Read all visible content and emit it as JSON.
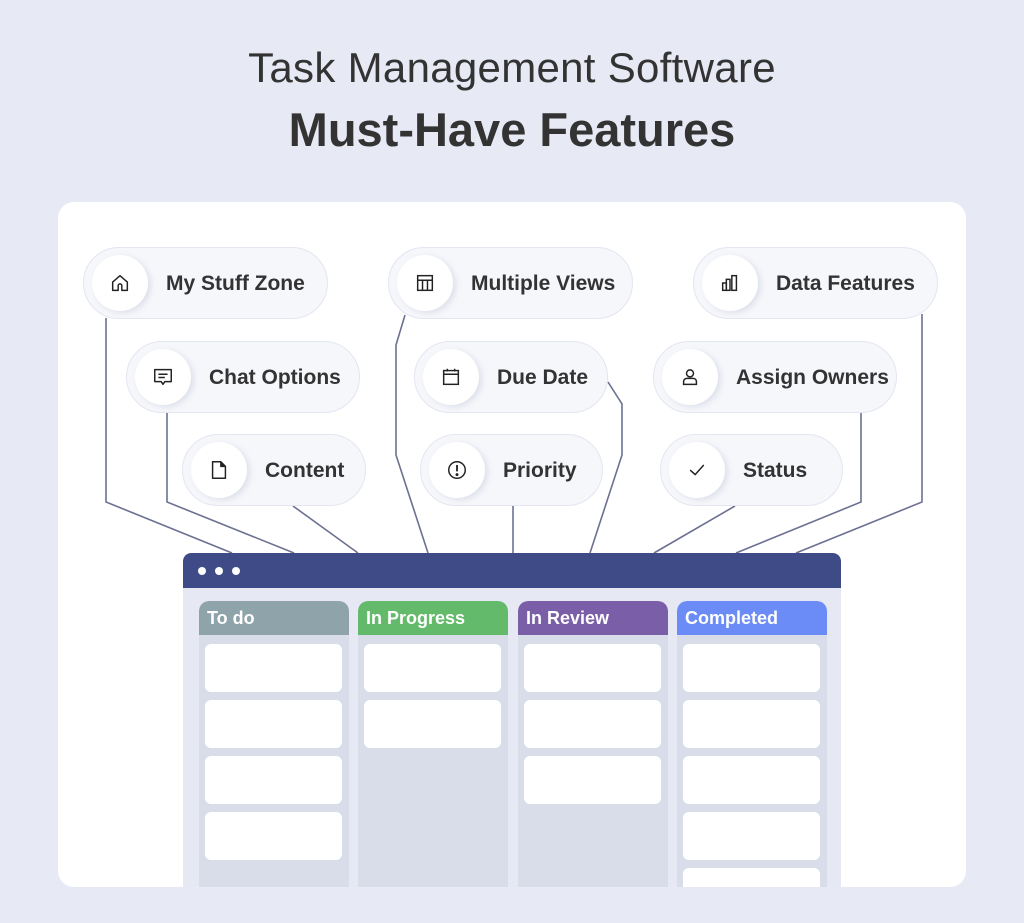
{
  "header": {
    "title": "Task Management Software",
    "subtitle": "Must-Have Features"
  },
  "features": [
    {
      "label": "My Stuff Zone",
      "icon": "home-icon"
    },
    {
      "label": "Chat Options",
      "icon": "chat-icon"
    },
    {
      "label": "Content",
      "icon": "document-icon"
    },
    {
      "label": "Multiple Views",
      "icon": "table-view-icon"
    },
    {
      "label": "Due Date",
      "icon": "calendar-icon"
    },
    {
      "label": "Priority",
      "icon": "exclamation-circle-icon"
    },
    {
      "label": "Data Features",
      "icon": "bar-chart-icon"
    },
    {
      "label": "Assign Owners",
      "icon": "user-icon"
    },
    {
      "label": "Status",
      "icon": "checkmark-icon"
    }
  ],
  "board": {
    "columns": [
      {
        "label": "To do",
        "color": "#8fa3ab",
        "task_count": 4
      },
      {
        "label": "In Progress",
        "color": "#63ba6a",
        "task_count": 2
      },
      {
        "label": "In Review",
        "color": "#7a5ea7",
        "task_count": 3
      },
      {
        "label": "Completed",
        "color": "#6b8cf7",
        "task_count": 5
      }
    ]
  },
  "colors": {
    "background": "#e7e9f5",
    "board_header": "#3f4b86",
    "connector": "#6c7192"
  }
}
